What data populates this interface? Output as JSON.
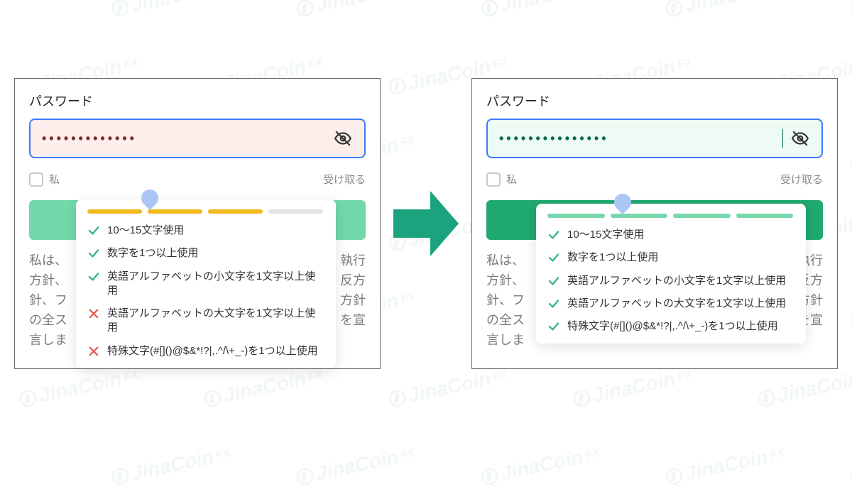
{
  "watermark_text": "JinaCoin",
  "watermark_sup": "FX",
  "left": {
    "label": "パスワード",
    "dots": "•••••••••••••",
    "checkbox_text_left": "私",
    "checkbox_text_right": "受け取る",
    "disclaimer_lines": [
      "私は、",
      "方針、",
      "針、フ",
      "の全ス",
      "言しま"
    ],
    "disclaimer_right": [
      "執行",
      "反方",
      "方針",
      "を宣"
    ],
    "strength": [
      "on-y",
      "on-y",
      "on-y",
      "off"
    ],
    "rules": [
      {
        "ok": true,
        "text": "10〜15文字使用"
      },
      {
        "ok": true,
        "text": "数字を1つ以上使用"
      },
      {
        "ok": true,
        "text": "英語アルファベットの小文字を1文字以上使用"
      },
      {
        "ok": false,
        "text": "英語アルファベットの大文字を1文字以上使用"
      },
      {
        "ok": false,
        "text": "特殊文字(#[]()@$&*!?|,.^/\\+_-)を1つ以上使用"
      }
    ]
  },
  "right": {
    "label": "パスワード",
    "dots": "•••••••••••••••",
    "checkbox_text_left": "私",
    "checkbox_text_right": "受け取る",
    "disclaimer_lines": [
      "私は、",
      "方針、",
      "針、フ",
      "の全ス",
      "言しま"
    ],
    "disclaimer_right": [
      "執行",
      "反方",
      "方針",
      "を宣"
    ],
    "strength": [
      "on-g",
      "on-g",
      "on-g",
      "on-g"
    ],
    "rules": [
      {
        "ok": true,
        "text": "10〜15文字使用"
      },
      {
        "ok": true,
        "text": "数字を1つ以上使用"
      },
      {
        "ok": true,
        "text": "英語アルファベットの小文字を1文字以上使用"
      },
      {
        "ok": true,
        "text": "英語アルファベットの大文字を1文字以上使用"
      },
      {
        "ok": true,
        "text": "特殊文字(#[]()@$&*!?|,.^/\\+_-)を1つ以上使用"
      }
    ]
  }
}
